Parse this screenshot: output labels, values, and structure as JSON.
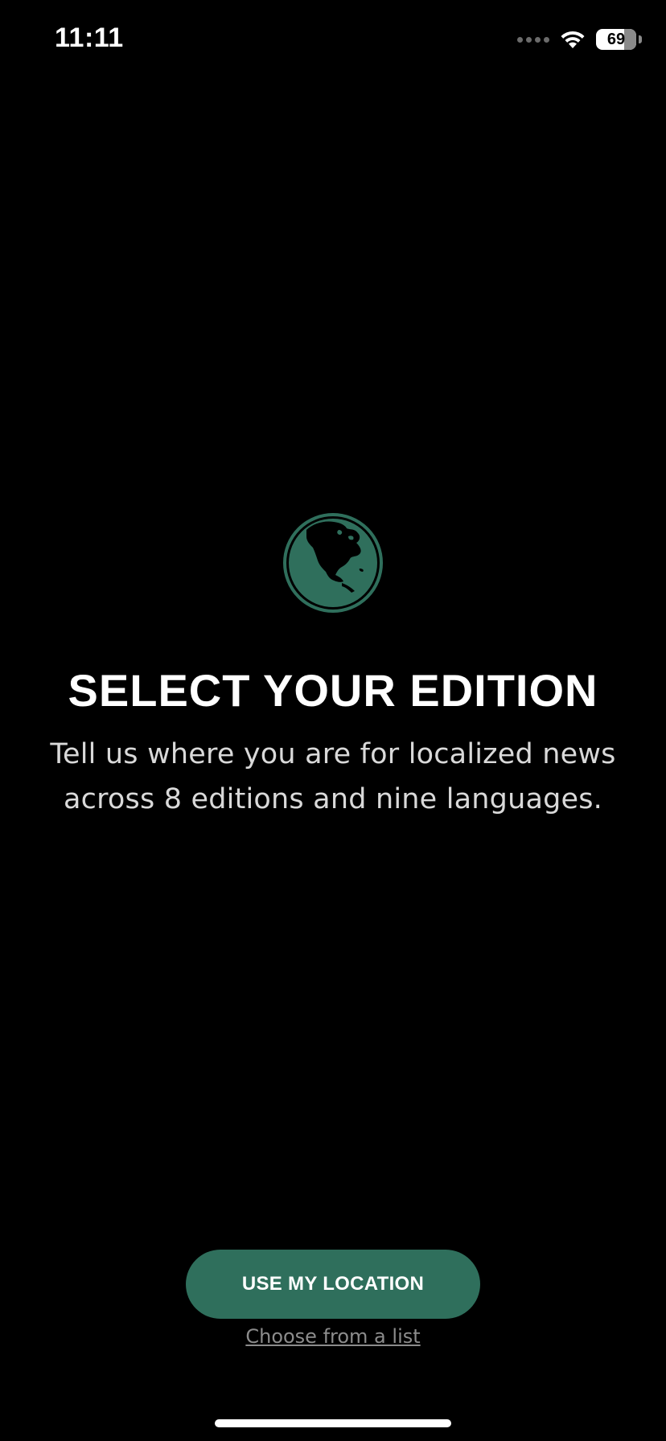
{
  "status_bar": {
    "time": "11:11",
    "battery_level": "69",
    "battery_fraction": 0.69,
    "icons": [
      "cellular-signal-icon",
      "wifi-icon",
      "battery-icon"
    ]
  },
  "main": {
    "icon": "globe-icon",
    "title": "SELECT YOUR EDITION",
    "subtitle": "Tell us where you are for localized news across 8 editions and nine languages."
  },
  "actions": {
    "primary_label": "USE MY LOCATION",
    "secondary_label": "Choose from a list"
  },
  "colors": {
    "background": "#000000",
    "accent": "#2f6f5c",
    "text": "#ffffff",
    "muted": "#8c8c8c"
  }
}
